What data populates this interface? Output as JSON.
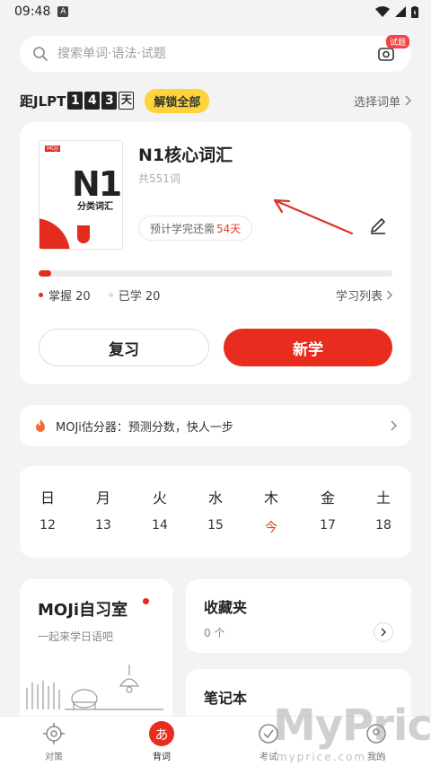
{
  "status": {
    "time": "09:48",
    "notif_letter": "A"
  },
  "search": {
    "placeholder": "搜索单词·语法·试题",
    "scan_badge": "试题"
  },
  "jlpt": {
    "prefix": "距JLPT",
    "digits": [
      "1",
      "4",
      "3"
    ],
    "suffix": "天",
    "unlock_label": "解锁全部",
    "choose_label": "选择词单"
  },
  "book": {
    "cover_brand": "MOJi",
    "cover_level": "N1",
    "cover_subtitle": "分类词汇",
    "title": "N1核心词汇",
    "count": "共551词",
    "estimate_prefix": "预计学完还需",
    "estimate_days": "54天",
    "progress_fraction": 0.036
  },
  "stats": {
    "mastered": "掌握 20",
    "learned": "已学 20",
    "list_link": "学习列表"
  },
  "buttons": {
    "review": "复习",
    "new": "新学"
  },
  "promo": {
    "text": "MOJi估分器：预测分数，快人一步"
  },
  "calendar": {
    "weekdays": [
      "日",
      "月",
      "火",
      "水",
      "木",
      "金",
      "土"
    ],
    "dates": [
      "12",
      "13",
      "14",
      "15",
      "今",
      "17",
      "18"
    ],
    "today_index": 4,
    "today_color": "#e63b2b"
  },
  "study_room": {
    "title": "MOJi自习室",
    "subtitle": "一起来学日语吧"
  },
  "favorites": {
    "title": "收藏夹",
    "count": "0 个"
  },
  "notes": {
    "title": "笔记本"
  },
  "tabs": {
    "strategy": "对策",
    "words": "背词",
    "words_icon_char": "あ",
    "exam": "考试",
    "mine": "我的"
  },
  "watermark": {
    "main": "MyPrice",
    "sub": "myprice.com.cn"
  },
  "colors": {
    "accent": "#e82d1e",
    "unlock_yellow": "#ffd43a"
  }
}
